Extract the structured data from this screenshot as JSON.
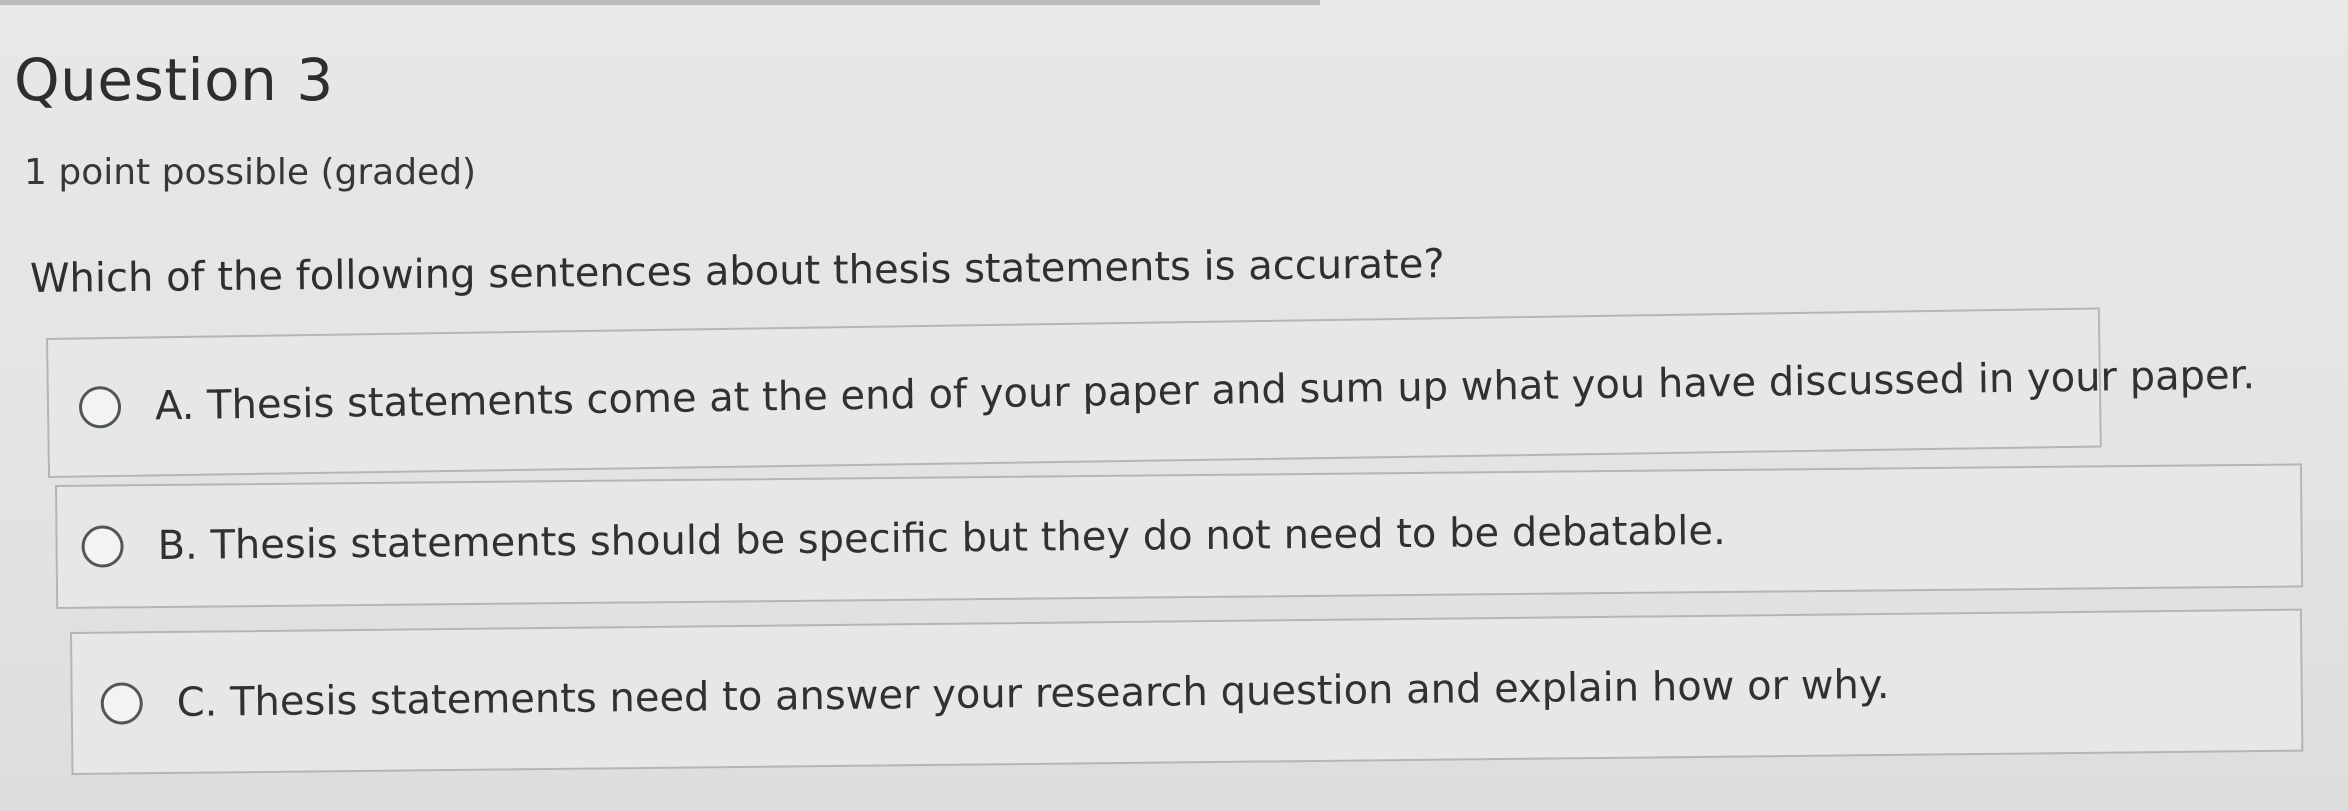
{
  "question": {
    "title": "Question 3",
    "points": "1 point possible (graded)",
    "prompt": "Which of the following sentences about thesis statements is accurate?"
  },
  "options": [
    {
      "label": "A. Thesis statements come at the end of your paper and sum up what you have discussed in your paper.",
      "selected": false
    },
    {
      "label": "B. Thesis statements should be specific but they do not need to be debatable.",
      "selected": false
    },
    {
      "label": "C. Thesis statements need to answer your research question and explain how or why.",
      "selected": false
    }
  ]
}
